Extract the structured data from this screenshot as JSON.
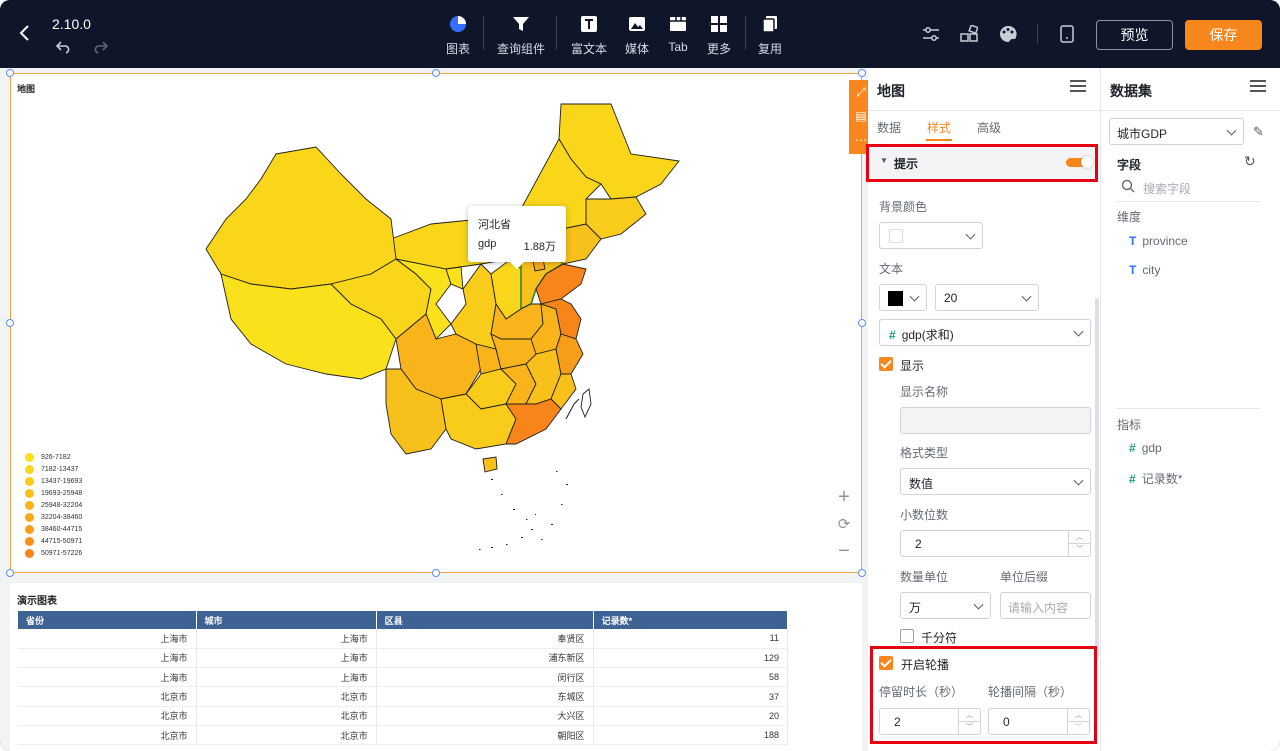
{
  "topbar": {
    "version": "2.10.0",
    "tools": [
      {
        "label": "图表",
        "icon": "pie-chart-icon"
      },
      {
        "label": "查询组件",
        "icon": "filter-icon"
      },
      {
        "label": "富文本",
        "icon": "text-icon"
      },
      {
        "label": "媒体",
        "icon": "image-icon"
      },
      {
        "label": "Tab",
        "icon": "tab-icon"
      },
      {
        "label": "更多",
        "icon": "grid-icon"
      },
      {
        "label": "复用",
        "icon": "copy-icon"
      }
    ],
    "preview_label": "预览",
    "save_label": "保存",
    "accent": "#f7861c"
  },
  "map": {
    "title": "地图",
    "tooltip": {
      "region": "河北省",
      "metric": "gdp",
      "value": "1.88万"
    },
    "legend": [
      {
        "label": "926-7182",
        "color": "#f9e21b"
      },
      {
        "label": "7182-13437",
        "color": "#f9d61a"
      },
      {
        "label": "13437-19693",
        "color": "#f9cb1a"
      },
      {
        "label": "19693-25948",
        "color": "#f8c01a"
      },
      {
        "label": "25948-32204",
        "color": "#f8b41a"
      },
      {
        "label": "32204-38460",
        "color": "#f8a91a"
      },
      {
        "label": "38460-44715",
        "color": "#f89d1a"
      },
      {
        "label": "44715-50971",
        "color": "#f8911a"
      },
      {
        "label": "50971-57226",
        "color": "#f8851a"
      }
    ]
  },
  "table": {
    "title": "演示图表",
    "columns": [
      "省份",
      "城市",
      "区县",
      "记录数*"
    ],
    "rows": [
      [
        "上海市",
        "上海市",
        "奉贤区",
        "11"
      ],
      [
        "上海市",
        "上海市",
        "浦东新区",
        "129"
      ],
      [
        "上海市",
        "上海市",
        "闵行区",
        "58"
      ],
      [
        "北京市",
        "北京市",
        "东城区",
        "37"
      ],
      [
        "北京市",
        "北京市",
        "大兴区",
        "20"
      ],
      [
        "北京市",
        "北京市",
        "朝阳区",
        "188"
      ]
    ]
  },
  "panel": {
    "title": "地图",
    "tabs": [
      "数据",
      "样式",
      "高级"
    ],
    "active_tab": "样式",
    "section": "提示",
    "bg_color_label": "背景颜色",
    "text_label": "文本",
    "font_size": "20",
    "field": "gdp(求和)",
    "show_label": "显示",
    "display_name_label": "显示名称",
    "format_type_label": "格式类型",
    "format_type": "数值",
    "decimals_label": "小数位数",
    "decimals": "2",
    "unit_label": "数量单位",
    "unit": "万",
    "suffix_label": "单位后缀",
    "suffix_placeholder": "请输入内容",
    "thousands_label": "千分符",
    "carousel_label": "开启轮播",
    "dwell_label": "停留时长（秒）",
    "dwell": "2",
    "interval_label": "轮播间隔（秒）",
    "interval": "0"
  },
  "dataset": {
    "title": "数据集",
    "selected": "城市GDP",
    "fields_label": "字段",
    "search_placeholder": "搜索字段",
    "dimension_label": "维度",
    "dimensions": [
      "province",
      "city"
    ],
    "metric_label": "指标",
    "metrics": [
      "gdp",
      "记录数*"
    ]
  }
}
